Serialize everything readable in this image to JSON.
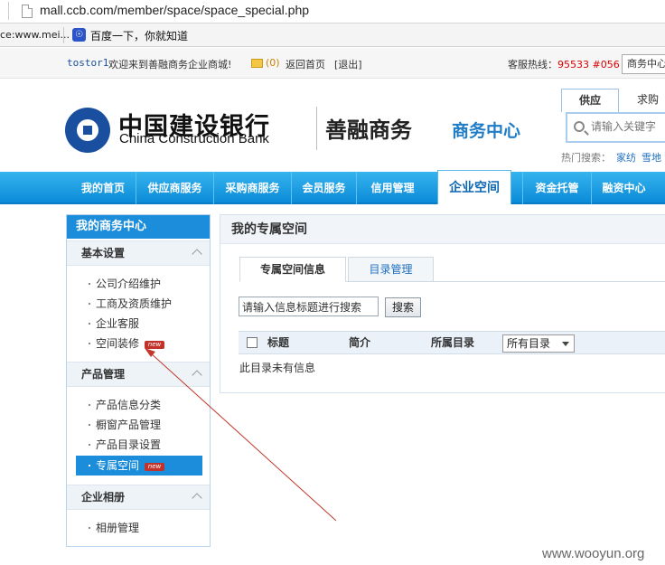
{
  "browser": {
    "url": "mall.ccb.com/member/space/space_special.php",
    "bookmark_1": "ce:www.mei...",
    "bookmark_2": "百度一下，你就知道"
  },
  "topbar": {
    "user": "tostor1",
    "welcome": "欢迎来到善融商务企业商城!",
    "mail_count": "(0)",
    "home_link": "返回首页",
    "logout_link": "[退出]",
    "hotline_label": "客服热线：",
    "hotline_number": "95533 #056",
    "selector_value": "商务中心"
  },
  "header": {
    "bank_name_cn": "中国建设银行",
    "bank_name_en": "China Construction Bank",
    "brand_main": "善融商务",
    "brand_sub": "商务中心",
    "search_tabs": [
      "供应",
      "求购"
    ],
    "search_placeholder": "请输入关键字",
    "hot_label": "热门搜索：",
    "hot_keywords": [
      "家纺",
      "雪地"
    ]
  },
  "nav": {
    "items": [
      "我的首页",
      "供应商服务",
      "采购商服务",
      "会员服务",
      "信用管理",
      "企业空间",
      "资金托管",
      "融资中心"
    ],
    "active": "企业空间"
  },
  "sidebar": {
    "title": "我的商务中心",
    "sections": [
      {
        "title": "基本设置",
        "items": [
          "公司介绍维护",
          "工商及资质维护",
          "企业客服",
          "空间装修"
        ]
      },
      {
        "title": "产品管理",
        "items": [
          "产品信息分类",
          "橱窗产品管理",
          "产品目录设置",
          "专属空间"
        ]
      },
      {
        "title": "企业相册",
        "items": [
          "相册管理"
        ]
      }
    ],
    "badge": "new"
  },
  "content": {
    "title": "我的专属空间",
    "tabs": [
      "专属空间信息",
      "目录管理"
    ],
    "search_value": "请输入信息标题进行搜索",
    "search_button": "搜索",
    "columns": [
      "标题",
      "简介",
      "所属目录"
    ],
    "filter_value": "所有目录",
    "empty_text": "此目录未有信息"
  },
  "watermark": "www.wooyun.org",
  "colors": {
    "nav_blue": "#0b8bd8",
    "accent_red": "#d00000",
    "annotation_arrow": "#c0392b"
  }
}
